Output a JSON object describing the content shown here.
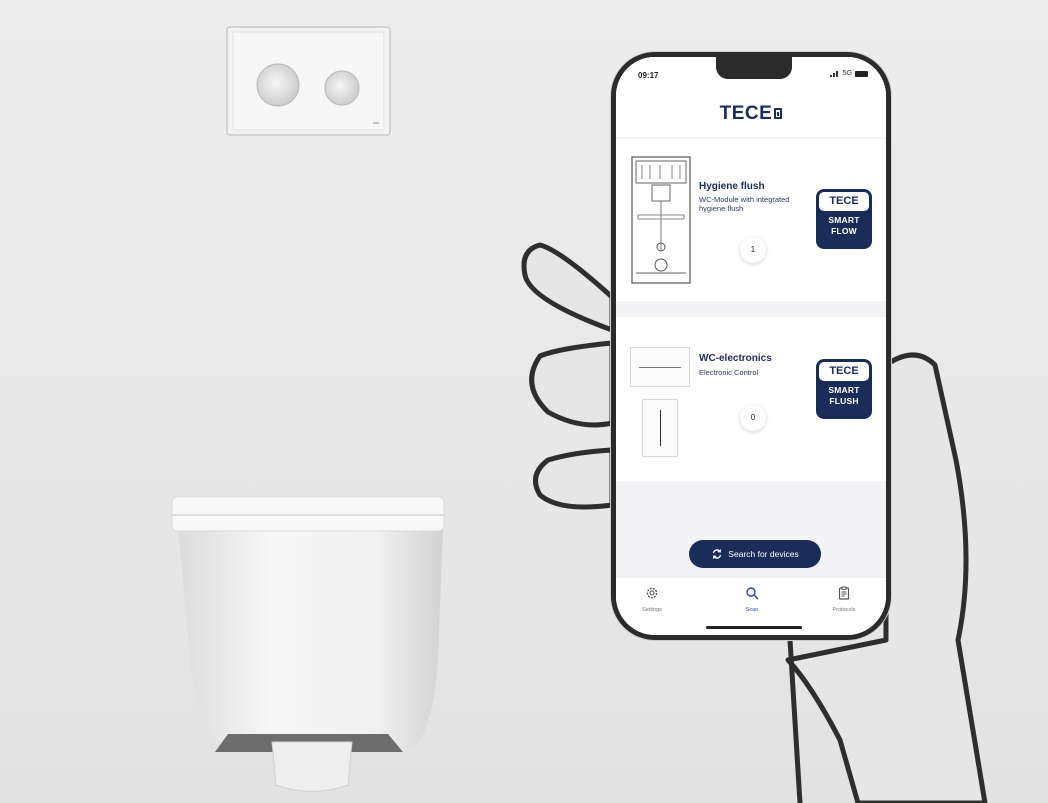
{
  "status_bar": {
    "time": "09:17",
    "network": "5G"
  },
  "app": {
    "brand": "TECE"
  },
  "devices": [
    {
      "title": "Hygiene flush",
      "subtitle": "WC-Module with integrated hygiene flush",
      "count": "1",
      "badge": {
        "brand": "TECE",
        "line1": "SMART",
        "line2": "FLOW"
      }
    },
    {
      "title": "WC-electronics",
      "subtitle": "Electronic Control",
      "count": "0",
      "badge": {
        "brand": "TECE",
        "line1": "SMART",
        "line2": "FLUSH"
      }
    }
  ],
  "search_button": {
    "label": "Search for devices",
    "icon": "refresh-icon"
  },
  "tabs": [
    {
      "label": "Settings",
      "icon": "gear-icon",
      "active": false
    },
    {
      "label": "Scan",
      "icon": "search-icon",
      "active": true
    },
    {
      "label": "Protocols",
      "icon": "clipboard-icon",
      "active": false
    }
  ],
  "colors": {
    "brand_navy": "#1a2c58",
    "active_tab": "#2d3fa8",
    "wall": "#ececec",
    "screen_bg": "#f4f4f6"
  }
}
